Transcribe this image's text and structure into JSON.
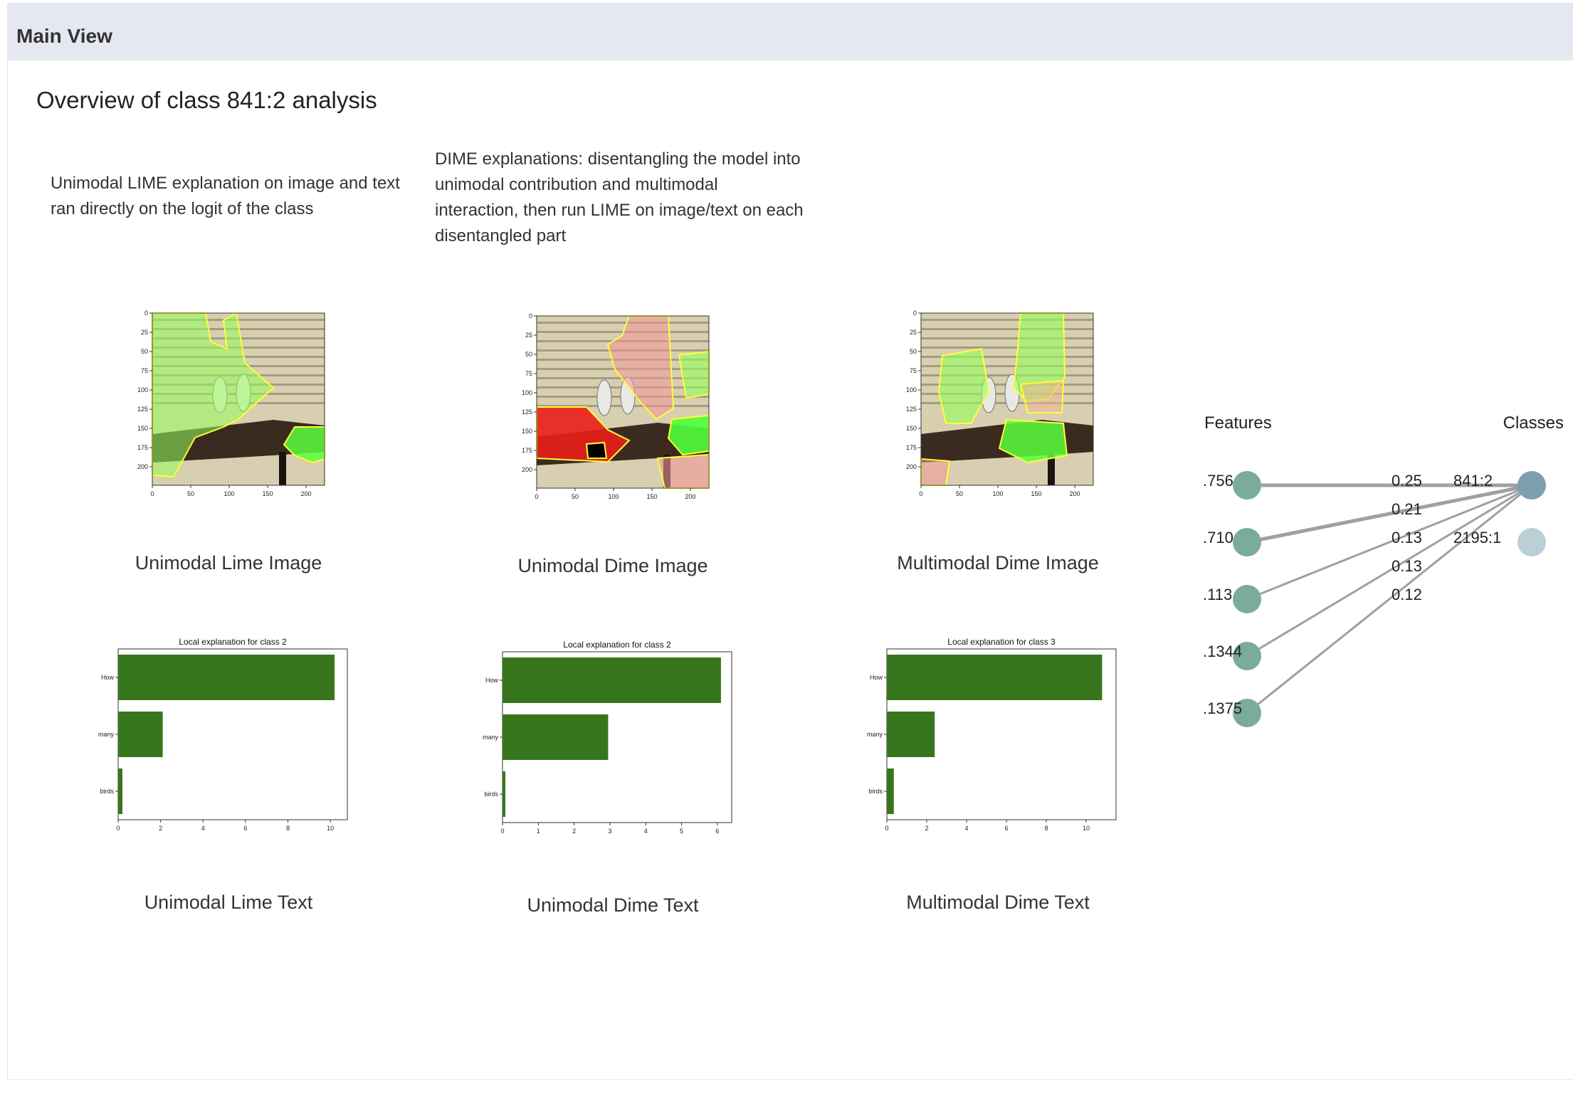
{
  "header": {
    "title": "Main View"
  },
  "page_title": "Overview of class 841:2 analysis",
  "descriptions": {
    "lime": "Unimodal LIME explanation on image and text ran directly on the logit of the class",
    "dime": "DIME explanations: disentangling the model into unimodal contribution and multimodal interaction, then run LIME on image/text on each disentangled part"
  },
  "images": [
    {
      "caption": "Unimodal Lime Image",
      "yticks": [
        "0",
        "25",
        "50",
        "75",
        "100",
        "125",
        "150",
        "175",
        "200"
      ],
      "xticks": [
        "0",
        "50",
        "100",
        "150",
        "200"
      ]
    },
    {
      "caption": "Unimodal Dime Image",
      "yticks": [
        "0",
        "25",
        "50",
        "75",
        "100",
        "125",
        "150",
        "175",
        "200"
      ],
      "xticks": [
        "0",
        "50",
        "100",
        "150",
        "200"
      ]
    },
    {
      "caption": "Multimodal Dime Image",
      "yticks": [
        "0",
        "25",
        "50",
        "75",
        "100",
        "125",
        "150",
        "175",
        "200"
      ],
      "xticks": [
        "0",
        "50",
        "100",
        "150",
        "200"
      ]
    }
  ],
  "text_captions": [
    "Unimodal Lime Text",
    "Unimodal Dime Text",
    "Multimodal Dime Text"
  ],
  "chart_data": [
    {
      "type": "bar",
      "orientation": "horizontal",
      "title": "Local explanation for class 2",
      "categories": [
        "How",
        "many",
        "birds"
      ],
      "values": [
        10.2,
        2.1,
        0.2
      ],
      "xlim": [
        0,
        10.8
      ],
      "xticks": [
        "0",
        "2",
        "4",
        "6",
        "8",
        "10"
      ],
      "color": "#38761d"
    },
    {
      "type": "bar",
      "orientation": "horizontal",
      "title": "Local explanation for class 2",
      "categories": [
        "How",
        "many",
        "birds"
      ],
      "values": [
        6.1,
        2.95,
        0.08
      ],
      "xlim": [
        0,
        6.4
      ],
      "xticks": [
        "0",
        "1",
        "2",
        "3",
        "4",
        "5",
        "6"
      ],
      "color": "#38761d"
    },
    {
      "type": "bar",
      "orientation": "horizontal",
      "title": "Local explanation for class 3",
      "categories": [
        "How",
        "many",
        "birds"
      ],
      "values": [
        10.8,
        2.4,
        0.35
      ],
      "xlim": [
        0,
        11.5
      ],
      "xticks": [
        "0",
        "2",
        "4",
        "6",
        "8",
        "10"
      ],
      "color": "#38761d"
    }
  ],
  "network": {
    "features_label": "Features",
    "classes_label": "Classes",
    "features": [
      ".756",
      ".710",
      ".113",
      ".1344",
      ".1375"
    ],
    "classes": [
      "841:2",
      "2195:1"
    ],
    "weights": [
      "0.25",
      "0.21",
      "0.13",
      "0.13",
      "0.12"
    ],
    "colors": {
      "feature": "#7aab9c",
      "class_active": "#7b9fae",
      "class_inactive": "#b9d0d6",
      "edge": "#a0a0a0"
    }
  }
}
